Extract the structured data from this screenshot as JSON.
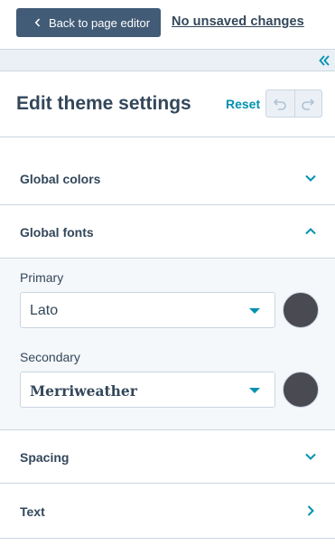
{
  "topbar": {
    "back_label": "Back to page editor",
    "status_link": "No unsaved changes"
  },
  "header": {
    "title": "Edit theme settings",
    "reset_label": "Reset"
  },
  "sections": {
    "global_colors": {
      "label": "Global colors",
      "expanded": false
    },
    "global_fonts": {
      "label": "Global fonts",
      "expanded": true
    },
    "spacing": {
      "label": "Spacing",
      "expanded": false
    },
    "text": {
      "label": "Text",
      "expanded": false
    }
  },
  "fonts": {
    "primary": {
      "label": "Primary",
      "value": "Lato",
      "color": "#4a4a52"
    },
    "secondary": {
      "label": "Secondary",
      "value": "Merriweather",
      "color": "#4a4a52"
    }
  },
  "colors": {
    "accent": "#0091ae",
    "button_dark": "#425b76",
    "text": "#33475b"
  },
  "icons": {
    "back": "chevron-left-icon",
    "collapse": "double-chevron-left-icon",
    "undo": "undo-icon",
    "redo": "redo-icon"
  }
}
